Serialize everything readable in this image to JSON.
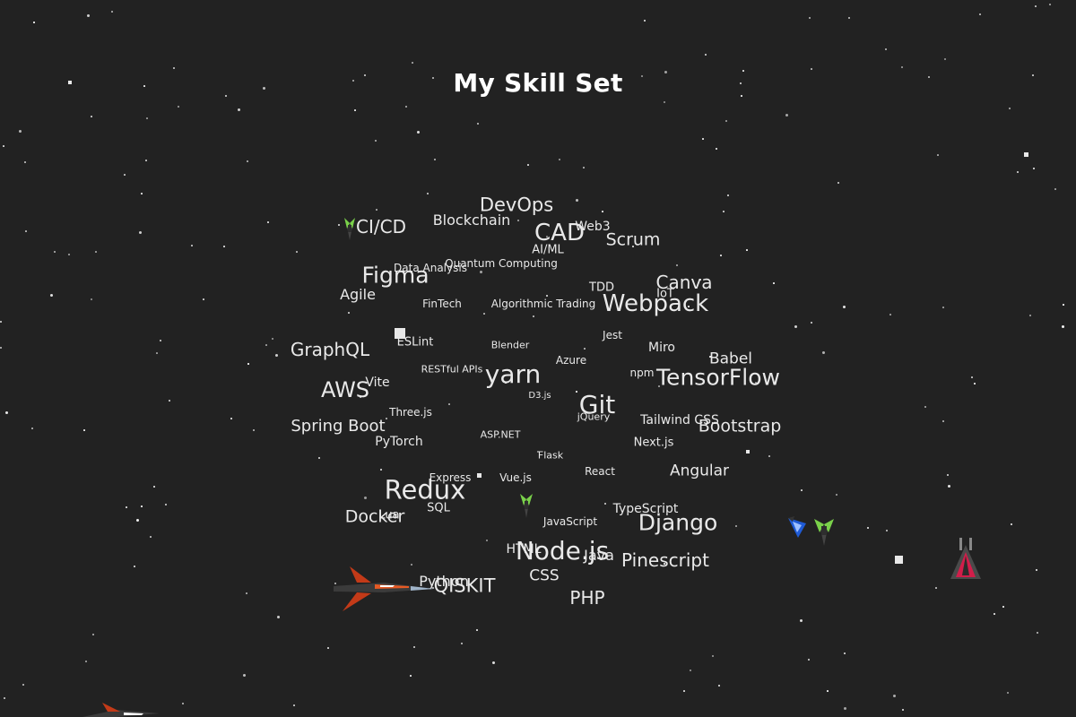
{
  "page": {
    "title": "My Skill Set"
  },
  "colors": {
    "background": "#222222",
    "text": "#e9e9e9",
    "title": "#ffffff"
  },
  "skills": [
    "DevOps",
    "CI/CD",
    "Blockchain",
    "CAD",
    "Web3",
    "Scrum",
    "AI/ML",
    "Quantum Computing",
    "Data Analysis",
    "Figma",
    "Agile",
    "FinTech",
    "Algorithmic Trading",
    "TDD",
    "Canva",
    "IoT",
    "Webpack",
    "GraphQL",
    "ESLint",
    "Blender",
    "Jest",
    "Miro",
    "Babel",
    "Azure",
    "RESTful APIs",
    "yarn",
    "npm",
    "TensorFlow",
    "AWS",
    "Vite",
    "D3.js",
    "Git",
    "jQuery",
    "Tailwind CSS",
    "Three.js",
    "Spring Boot",
    "Bootstrap",
    "PyTorch",
    "ASP.NET",
    "Next.js",
    "Flask",
    "React",
    "Angular",
    "Express",
    "Vue.js",
    "Redux",
    "SQL",
    "Lua",
    "Docker",
    "TypeScript",
    "JavaScript",
    "Django",
    "HTML",
    "Node.js",
    "Java",
    "Pinescript",
    "Python",
    "QISKIT",
    "CSS",
    "PHP"
  ],
  "icons": {
    "green_ship": "green-spaceship-icon",
    "blue_ship": "blue-spaceship-icon",
    "red_ship": "red-spaceship-icon",
    "jet": "orange-jet-icon"
  }
}
